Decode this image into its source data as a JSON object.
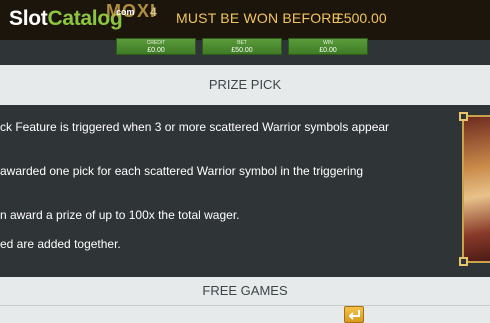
{
  "header": {
    "logo_slot": "Slot",
    "logo_catalog": "Catalog",
    "logo_com": "com",
    "game_logo": "MOXI",
    "game_logo_b": "4",
    "jackpot_message": "MUST BE WON BEFORE",
    "jackpot_amount": "£500.00"
  },
  "meters": [
    {
      "label": "CREDIT",
      "value": "£0.00"
    },
    {
      "label": "BET",
      "value": "£50.00"
    },
    {
      "label": "WIN",
      "value": "£0.00"
    }
  ],
  "sections": {
    "prize_pick_title": "PRIZE PICK",
    "free_games_title": "FREE GAMES"
  },
  "prize_pick_lines": [
    "ck Feature is triggered when 3 or more scattered Warrior symbols appear",
    "awarded one pick for each scattered Warrior symbol in the triggering",
    "n award a prize of up to 100x the total wager.",
    "ed are added together."
  ],
  "colors": {
    "jackpot_text": "#f2c55b",
    "logo_green": "#8cc63f",
    "meter_green": "#4a8a2e",
    "section_bar": "#e7eaeb",
    "body_bg": "#2f3436"
  },
  "icons": {
    "back": "return-arrow-icon"
  }
}
